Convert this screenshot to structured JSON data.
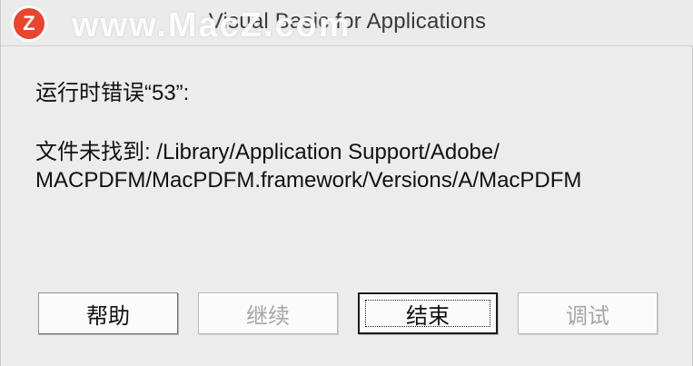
{
  "window": {
    "title": "Visual Basic for Applications",
    "watermark_text": "www.MacZ.com",
    "watermark_logo": "Z"
  },
  "dialog": {
    "error_title": "运行时错误“53”:",
    "error_message_line1": "文件未找到: /Library/Application Support/Adobe/",
    "error_message_line2": "MACPDFM/MacPDFM.framework/Versions/A/MacPDFM"
  },
  "buttons": {
    "help": {
      "label": "帮助",
      "enabled": true
    },
    "continue": {
      "label": "继续",
      "enabled": false
    },
    "end": {
      "label": "结束",
      "enabled": true,
      "default": true
    },
    "debug": {
      "label": "调试",
      "enabled": false
    }
  }
}
